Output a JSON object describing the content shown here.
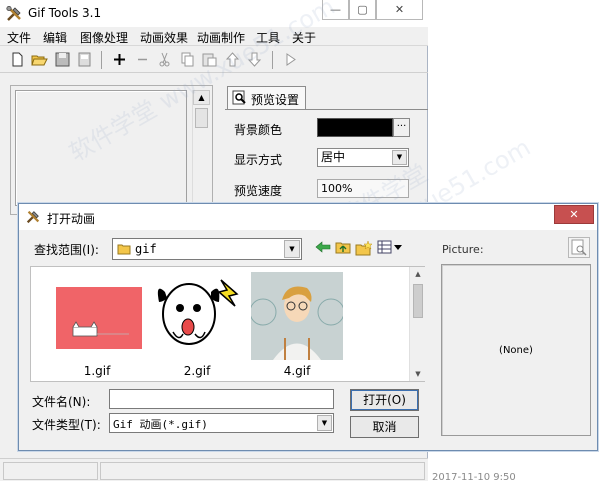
{
  "main_window": {
    "title": "Gif Tools 3.1",
    "menu": [
      "文件",
      "编辑",
      "图像处理",
      "动画效果",
      "动画制作",
      "工具",
      "关于"
    ],
    "toolbar_icons": [
      "new-file-icon",
      "open-folder-icon",
      "save-icon",
      "save-as-icon",
      "add-icon",
      "remove-icon",
      "cut-icon",
      "copy-icon",
      "paste-icon",
      "move-up-icon",
      "move-down-icon",
      "play-icon"
    ],
    "settings": {
      "tab_label": "预览设置",
      "bg_color_label": "背景颜色",
      "bg_color": "#000000",
      "display_mode_label": "显示方式",
      "display_mode_value": "居中",
      "speed_label": "预览速度",
      "speed_value": "100%"
    },
    "status_time": "2017-11-10 9:50"
  },
  "dialog": {
    "title": "打开动画",
    "look_in_label": "查找范围(I):",
    "look_in_value": "gif",
    "picture_label": "Picture:",
    "preview_text": "(None)",
    "files": [
      {
        "name": "1.gif",
        "bg": "#f06468"
      },
      {
        "name": "2.gif",
        "bg": "#ffffff"
      },
      {
        "name": "4.gif",
        "bg": "#c8d2d2"
      }
    ],
    "file_name_label": "文件名(N):",
    "file_name_value": "",
    "file_type_label": "文件类型(T):",
    "file_type_value": "Gif 动画(*.gif)",
    "open_button": "打开(O)",
    "cancel_button": "取消"
  },
  "watermark": "软件学堂 www.xue51.com"
}
